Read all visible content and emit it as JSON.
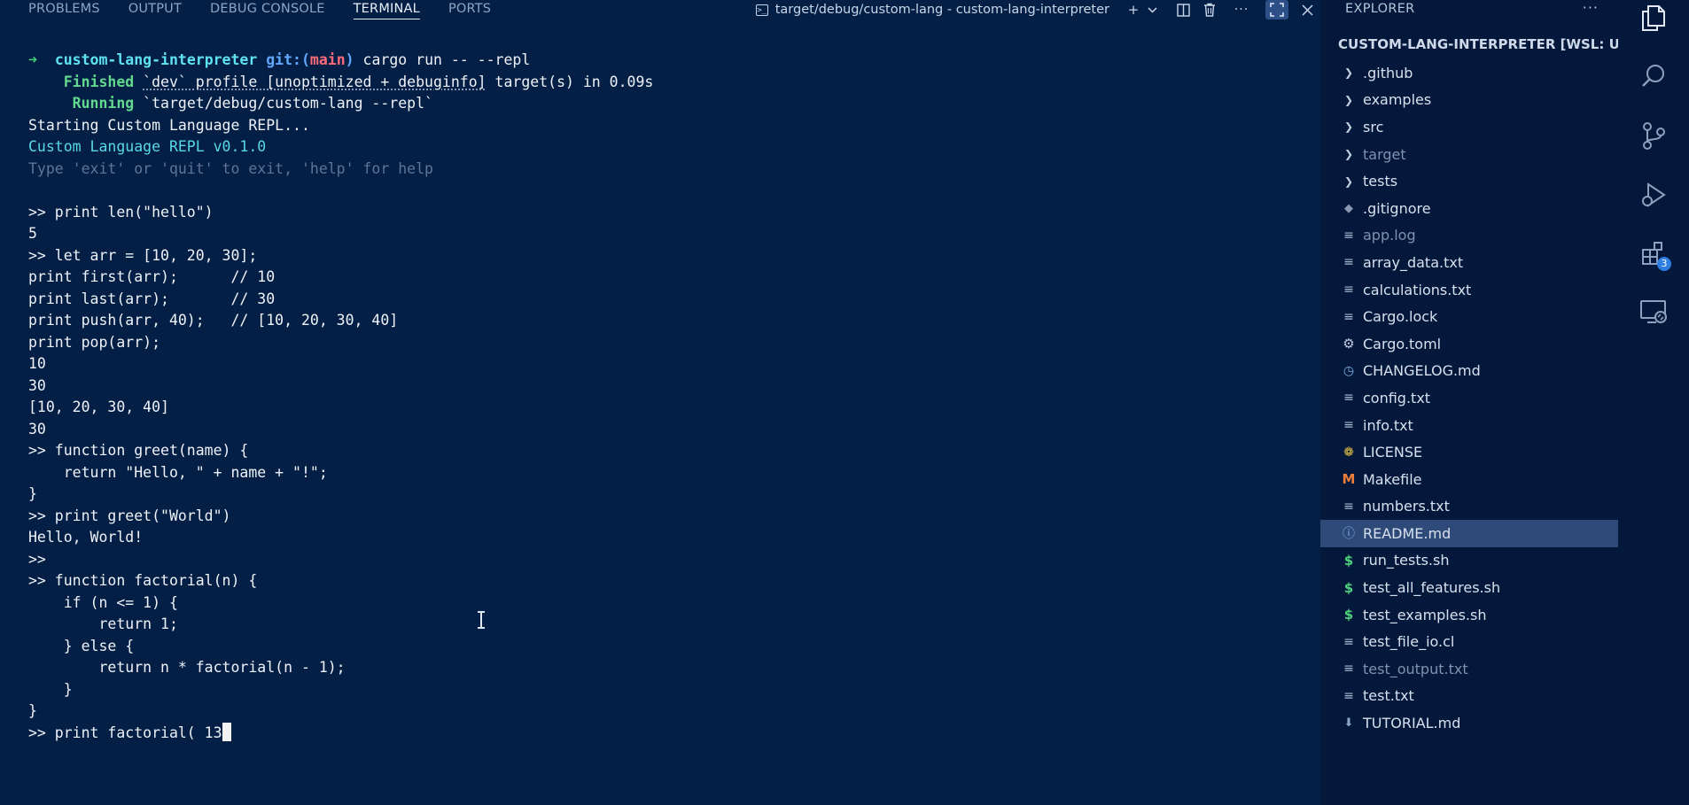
{
  "panel": {
    "tabs": [
      {
        "label": "PROBLEMS"
      },
      {
        "label": "OUTPUT"
      },
      {
        "label": "DEBUG CONSOLE"
      },
      {
        "label": "TERMINAL"
      },
      {
        "label": "PORTS"
      }
    ],
    "active_tab": "TERMINAL",
    "terminal_title": "target/debug/custom-lang - custom-lang-interpreter"
  },
  "terminal": {
    "prompt_arrow": "➜",
    "prompt_dir": "custom-lang-interpreter",
    "prompt_git_prefix": "git:(",
    "prompt_branch": "main",
    "prompt_git_suffix": ")",
    "prompt_command": " cargo run -- --repl",
    "finished_label": "Finished",
    "finished_profile": "`dev` profile [unoptimized + debuginfo]",
    "finished_rest": " target(s) in 0.09s",
    "running_label": "Running",
    "running_rest": " `target/debug/custom-lang --repl`",
    "starting": "Starting Custom Language REPL...",
    "version": "Custom Language REPL v0.1.0",
    "hint": "Type 'exit' or 'quit' to exit, 'help' for help",
    "lines": [
      "",
      ">> print len(\"hello\")",
      "5",
      ">> let arr = [10, 20, 30];",
      "print first(arr);      // 10",
      "print last(arr);       // 30",
      "print push(arr, 40);   // [10, 20, 30, 40]",
      "print pop(arr);",
      "10",
      "30",
      "[10, 20, 30, 40]",
      "30",
      ">> function greet(name) {",
      "    return \"Hello, \" + name + \"!\";",
      "}",
      ">> print greet(\"World\")",
      "Hello, World!",
      ">>",
      ">> function factorial(n) {",
      "    if (n <= 1) {",
      "        return 1;",
      "    } else {",
      "        return n * factorial(n - 1);",
      "    }",
      "}"
    ],
    "current_input": ">> print factorial( 13"
  },
  "explorer": {
    "title": "EXPLORER",
    "project": "CUSTOM-LANG-INTERPRETER [WSL: UB...",
    "items": [
      {
        "label": ".github",
        "icon": "chevron-right-icon",
        "dim": false
      },
      {
        "label": "examples",
        "icon": "chevron-right-icon",
        "dim": false
      },
      {
        "label": "src",
        "icon": "chevron-right-icon",
        "dim": false
      },
      {
        "label": "target",
        "icon": "chevron-right-icon",
        "dim": true
      },
      {
        "label": "tests",
        "icon": "chevron-right-icon",
        "dim": false
      },
      {
        "label": ".gitignore",
        "icon": "git-icon",
        "dim": false
      },
      {
        "label": "app.log",
        "icon": "lines-icon",
        "dim": true
      },
      {
        "label": "array_data.txt",
        "icon": "lines-icon",
        "dim": false
      },
      {
        "label": "calculations.txt",
        "icon": "lines-icon",
        "dim": false
      },
      {
        "label": "Cargo.lock",
        "icon": "lines-icon",
        "dim": false
      },
      {
        "label": "Cargo.toml",
        "icon": "gear-icon",
        "dim": false
      },
      {
        "label": "CHANGELOG.md",
        "icon": "clock-icon",
        "dim": false
      },
      {
        "label": "config.txt",
        "icon": "lines-icon",
        "dim": false
      },
      {
        "label": "info.txt",
        "icon": "lines-icon",
        "dim": false
      },
      {
        "label": "LICENSE",
        "icon": "license-icon",
        "dim": false
      },
      {
        "label": "Makefile",
        "icon": "makefile-icon",
        "dim": false
      },
      {
        "label": "numbers.txt",
        "icon": "lines-icon",
        "dim": false
      },
      {
        "label": "README.md",
        "icon": "info-icon",
        "dim": false,
        "selected": true
      },
      {
        "label": "run_tests.sh",
        "icon": "dollar-icon",
        "dim": false
      },
      {
        "label": "test_all_features.sh",
        "icon": "dollar-icon",
        "dim": false
      },
      {
        "label": "test_examples.sh",
        "icon": "dollar-icon",
        "dim": false
      },
      {
        "label": "test_file_io.cl",
        "icon": "lines-icon",
        "dim": false
      },
      {
        "label": "test_output.txt",
        "icon": "lines-icon",
        "dim": true
      },
      {
        "label": "test.txt",
        "icon": "lines-icon",
        "dim": false
      },
      {
        "label": "TUTORIAL.md",
        "icon": "download-icon",
        "dim": false
      }
    ]
  },
  "activity": {
    "extensions_badge": "3"
  },
  "colors": {
    "background": "#041f45",
    "sidebar": "#03183a",
    "selected": "#2e4a78",
    "prompt_green": "#40d47a",
    "prompt_cyan": "#5fe3f2",
    "branch_red": "#ff6b7a"
  }
}
